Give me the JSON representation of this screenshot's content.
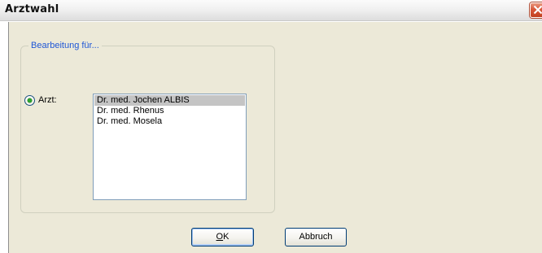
{
  "window": {
    "title": "Arztwahl",
    "close_icon": "close-icon"
  },
  "group": {
    "legend": "Bearbeitung für..."
  },
  "radio": {
    "label": "Arzt:",
    "checked": true
  },
  "doctor_list": {
    "items": [
      "Dr. med. Jochen ALBIS",
      "Dr. med. Rhenus",
      "Dr. med. Mosela"
    ],
    "selected_index": 0
  },
  "buttons": {
    "ok_mnemonic": "O",
    "ok_rest": "K",
    "cancel_label": "Abbruch"
  },
  "colors": {
    "legend_text": "#1f57d6",
    "dialog_background": "#ece9d8",
    "selection": "#c4c4c4",
    "close_button": "#d8583a"
  }
}
